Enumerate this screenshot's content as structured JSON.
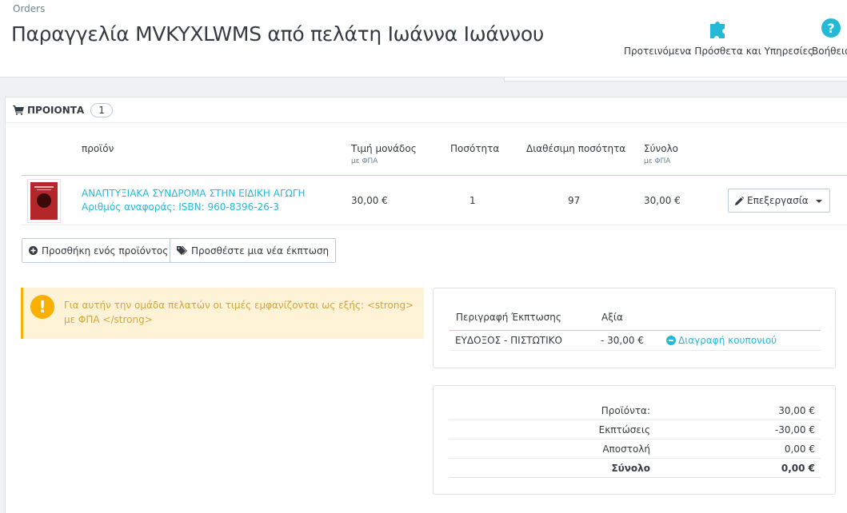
{
  "header": {
    "breadcrumb": "Orders",
    "title": "Παραγγελία MVKYXLWMS από πελάτη Ιωάννα Ιωάννου",
    "toolbar": [
      {
        "label": "Προτεινόμενα Πρόσθετα και Υπηρεσίες",
        "icon": "puzzle-icon"
      },
      {
        "label": "Βοήθεια",
        "icon": "help-icon"
      }
    ],
    "accent_color": "#25b9d7"
  },
  "products_panel": {
    "title": "ΠΡΟΙΟΝΤΑ",
    "count": "1",
    "columns": {
      "product": "προϊόν",
      "unit_price": "Τιμή μονάδος",
      "unit_price_sub": "με ΦΠΑ",
      "quantity": "Ποσότητα",
      "available": "Διαθέσιμη ποσότητα",
      "total": "Σύνολο",
      "total_sub": "με ΦΠΑ"
    },
    "rows": [
      {
        "name": "ΑΝΑΠΤΥΞΙΑΚΑ ΣΥΝΔΡΟΜΑ ΣΤΗΝ ΕΙΔΙΚΗ ΑΓΩΓΗ",
        "reference": "Αριθμός αναφοράς: ISBN: 960-8396-26-3",
        "unit_price": "30,00 €",
        "quantity": "1",
        "available": "97",
        "total": "30,00 €",
        "edit_label": "Επεξεργασία"
      }
    ],
    "add_product_label": "Προσθήκη ενός προϊόντος",
    "add_discount_label": "Προσθέστε μια νέα έκπτωση"
  },
  "alert": {
    "message": "Για αυτήν την ομάδα πελατών οι τιμές εμφανίζονται ως εξής: <strong> με ΦΠΑ </strong>",
    "color": "#fab000"
  },
  "discounts": {
    "col_description": "Περιγραφή Έκπτωσης",
    "col_value": "Αξία",
    "rows": [
      {
        "description": "ΕΥΔΟΞΟΣ - ΠΙΣΤΩΤΙΚΟ",
        "value": "- 30,00 €",
        "action": "Διαγραφή κουπονιού"
      }
    ]
  },
  "totals": [
    {
      "label": "Προϊόντα:",
      "value": "30,00 €"
    },
    {
      "label": "Εκπτώσεις",
      "value": "-30,00 €"
    },
    {
      "label": "Αποστολή",
      "value": "0,00 €"
    },
    {
      "label": "Σύνολο",
      "value": "0,00 €"
    }
  ]
}
